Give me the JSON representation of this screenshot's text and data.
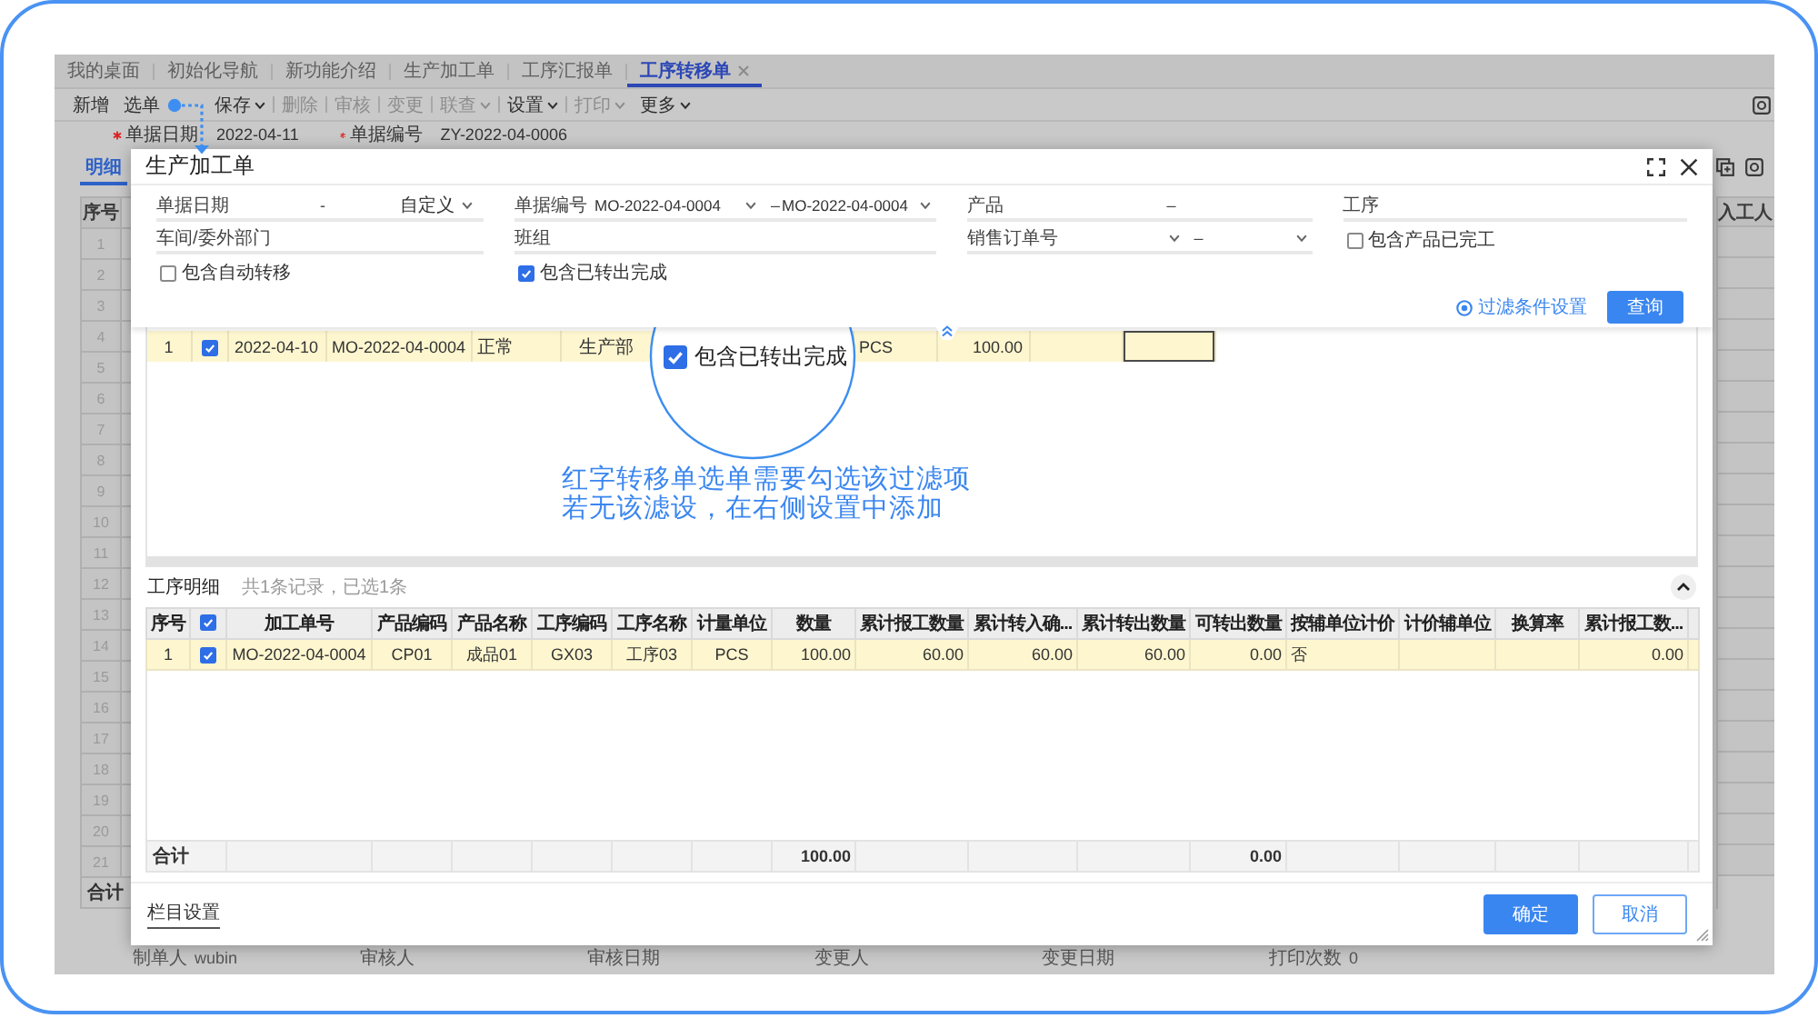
{
  "app_tabs": [
    {
      "label": "我的桌面",
      "selected": false
    },
    {
      "label": "初始化导航",
      "selected": false
    },
    {
      "label": "新功能介绍",
      "selected": false
    },
    {
      "label": "生产加工单",
      "selected": false
    },
    {
      "label": "工序汇报单",
      "selected": false
    },
    {
      "label": "工序转移单",
      "selected": true
    }
  ],
  "toolbar": [
    {
      "label": "新增",
      "disabled": false,
      "dropdown": false
    },
    {
      "label": "选单",
      "disabled": false,
      "dropdown": false
    },
    {
      "label": "保存",
      "disabled": false,
      "dropdown": true
    },
    {
      "label": "删除",
      "disabled": true,
      "dropdown": false
    },
    {
      "label": "审核",
      "disabled": true,
      "dropdown": false
    },
    {
      "label": "变更",
      "disabled": true,
      "dropdown": false
    },
    {
      "label": "联查",
      "disabled": true,
      "dropdown": true
    },
    {
      "label": "设置",
      "disabled": false,
      "dropdown": true
    },
    {
      "label": "打印",
      "disabled": true,
      "dropdown": true
    },
    {
      "label": "更多",
      "disabled": false,
      "dropdown": true
    }
  ],
  "header_fields": [
    {
      "label": "单据日期",
      "value": "2022-04-11",
      "required": true
    },
    {
      "label": "单据编号",
      "value": "ZY-2022-04-0006",
      "required": true
    }
  ],
  "sub_tabs": [
    {
      "label": "明细",
      "selected": true
    }
  ],
  "entry_grid": {
    "column": "序号",
    "rows": [
      "1",
      "2",
      "3",
      "4",
      "5",
      "6",
      "7",
      "8",
      "9",
      "10",
      "11",
      "12",
      "13",
      "14",
      "15",
      "16",
      "17",
      "18",
      "19",
      "20",
      "21"
    ],
    "total_label": "合计",
    "right_column": "入工人"
  },
  "footer_info": [
    {
      "label": "制单人",
      "value": "wubin"
    },
    {
      "label": "审核人"
    },
    {
      "label": "审核日期"
    },
    {
      "label": "变更人"
    },
    {
      "label": "变更日期"
    },
    {
      "label": "打印次数",
      "value": "0"
    }
  ],
  "dialog": {
    "title": "生产加工单",
    "filters": [
      {
        "kind": "date",
        "label": "单据日期",
        "separator": "-",
        "mode": "自定义"
      },
      {
        "kind": "range",
        "label": "单据编号",
        "from": "MO-2022-04-0004",
        "separator": "–",
        "to": "MO-2022-04-0004",
        "dropdown": true
      },
      {
        "kind": "range",
        "label": "产品",
        "separator": "–",
        "dropdown": false
      },
      {
        "kind": "text",
        "label": "工序"
      },
      {
        "kind": "text",
        "label": "车间/委外部门"
      },
      {
        "kind": "text",
        "label": "班组"
      },
      {
        "kind": "range",
        "label": "销售订单号",
        "separator": "–",
        "dropdown": true
      },
      {
        "kind": "checkbox",
        "label": "包含产品已完工",
        "checked": false
      },
      {
        "kind": "checkbox",
        "label": "包含自动转移",
        "checked": false
      },
      {
        "kind": "checkbox",
        "label": "包含已转出完成",
        "checked": true
      }
    ],
    "filter_settings": "过滤条件设置",
    "query_button": "查询",
    "orders": {
      "rows": [
        {
          "selected": true,
          "checked": true,
          "cells": [
            {
              "text": "1",
              "focused": false
            },
            {
              "text": "2022-04-10",
              "focused": false
            },
            {
              "text": "MO-2022-04-0004",
              "focused": false
            },
            {
              "text": "正常",
              "focused": false
            },
            {
              "text": "生产部",
              "focused": false
            },
            null,
            null,
            {
              "text": "PCS",
              "focused": false
            },
            {
              "text": "100.00",
              "focused": false
            },
            {
              "focused": false
            },
            {
              "focused": true
            }
          ]
        }
      ]
    },
    "magnifier": {
      "label": "包含已转出完成",
      "checked": true
    },
    "annotation": [
      "红字转移单选单需要勾选该过滤项",
      "若无该滤设，在右侧设置中添加"
    ],
    "details": {
      "title": "工序明细",
      "summary": "共1条记录，已选1条",
      "select_all": {
        "checked": true
      },
      "columns": [
        "序号",
        "加工单号",
        "产品编码",
        "产品名称",
        "工序编码",
        "工序名称",
        "计量单位",
        "数量",
        "累计报工数量",
        "累计转入确...",
        "累计转出数量",
        "可转出数量",
        "按辅单位计价",
        "计价辅单位",
        "换算率",
        "累计报工数..."
      ],
      "rows": [
        {
          "selected": true,
          "checked": true,
          "cells": [
            "1",
            "MO-2022-04-0004",
            "CP01",
            "成品01",
            "GX03",
            "工序03",
            "PCS",
            "100.00",
            "60.00",
            "60.00",
            "60.00",
            "0.00",
            "否",
            null,
            null,
            "0.00"
          ]
        }
      ],
      "total": {
        "label": "合计",
        "cells": [
          null,
          null,
          null,
          null,
          null,
          null,
          "100.00",
          null,
          null,
          null,
          "0.00",
          null,
          null,
          null,
          null
        ]
      }
    },
    "column_settings": "栏目设置",
    "buttons": [
      {
        "label": "确定",
        "kind": "primary"
      },
      {
        "label": "取消",
        "kind": "default"
      }
    ]
  }
}
